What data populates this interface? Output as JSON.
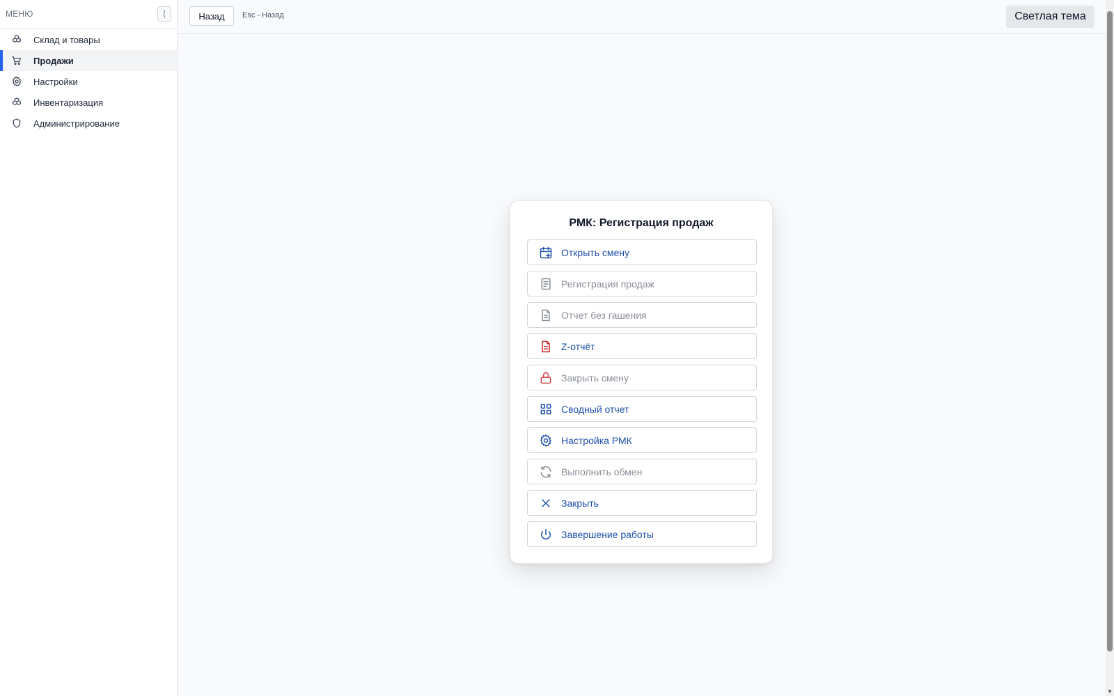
{
  "sidebar": {
    "title": "МЕНЮ",
    "collapse_glyph": "⟨",
    "items": [
      {
        "label": "Склад и товары",
        "icon": "boxes-icon"
      },
      {
        "label": "Продажи",
        "icon": "cart-icon",
        "active": true
      },
      {
        "label": "Настройки",
        "icon": "gear-icon"
      },
      {
        "label": "Инвентаризация",
        "icon": "boxes-icon"
      },
      {
        "label": "Администрирование",
        "icon": "shield-icon"
      }
    ]
  },
  "topbar": {
    "back_label": "Назад",
    "back_hint": "Esc - Назад",
    "theme_label": "Светлая тема"
  },
  "dialog": {
    "title": "РМК: Регистрация продаж",
    "buttons": [
      {
        "label": "Открыть смену",
        "icon": "calendar-plus-icon",
        "enabled": true,
        "icon_color": "#1e4fa8"
      },
      {
        "label": "Регистрация продаж",
        "icon": "document-icon",
        "enabled": false,
        "icon_color": "#8a8f98"
      },
      {
        "label": "Отчет без гашения",
        "icon": "document-lines-icon",
        "enabled": false,
        "icon_color": "#8a8f98"
      },
      {
        "label": "Z-отчёт",
        "icon": "document-red-icon",
        "enabled": true,
        "icon_color": "#c62828"
      },
      {
        "label": "Закрыть смену",
        "icon": "lock-icon",
        "enabled": false,
        "icon_color": "#d34545"
      },
      {
        "label": "Сводный отчет",
        "icon": "grid-icon",
        "enabled": true,
        "icon_color": "#1e4fa8"
      },
      {
        "label": "Настройка РМК",
        "icon": "gear-icon",
        "enabled": true,
        "icon_color": "#1e4fa8"
      },
      {
        "label": "Выполнить обмен",
        "icon": "refresh-icon",
        "enabled": false,
        "icon_color": "#8a8f98"
      },
      {
        "label": "Закрыть",
        "icon": "close-icon",
        "enabled": true,
        "icon_color": "#1e4fa8"
      },
      {
        "label": "Завершение работы",
        "icon": "power-icon",
        "enabled": true,
        "icon_color": "#1e4fa8"
      }
    ]
  },
  "colors": {
    "accent": "#2563eb",
    "link_blue": "#1e4fa8",
    "disabled": "#8a8f98",
    "danger": "#c62828"
  }
}
